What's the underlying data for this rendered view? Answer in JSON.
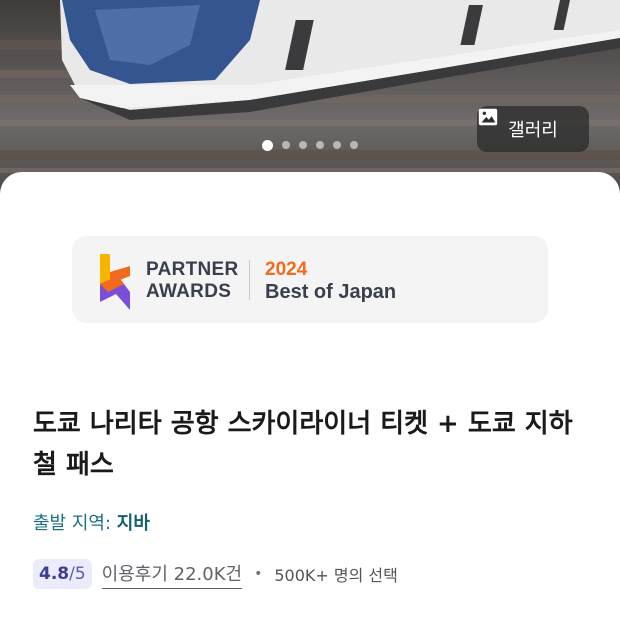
{
  "hero": {
    "gallery_label": "갤러리",
    "gallery_icon": "image-icon",
    "carousel_count": 6,
    "carousel_active_index": 0
  },
  "award": {
    "line1": "PARTNER",
    "line2": "AWARDS",
    "year": "2024",
    "subtitle": "Best of Japan",
    "colors": {
      "year": "#f26b1d",
      "text": "#3a3f4e",
      "logo_yellow": "#f7b500",
      "logo_orange": "#f26b1d",
      "logo_purple": "#7a4fd6"
    }
  },
  "product": {
    "title": "도쿄 나리타 공항 스카이라이너 티켓 + 도쿄 지하철 패스",
    "departure_label": "출발 지역:",
    "departure_city": "지바",
    "rating": "4.8",
    "rating_max": "/5",
    "reviews": "이용후기 22.0K건",
    "separator": "•",
    "picks": "500K+ 명의 선택"
  }
}
